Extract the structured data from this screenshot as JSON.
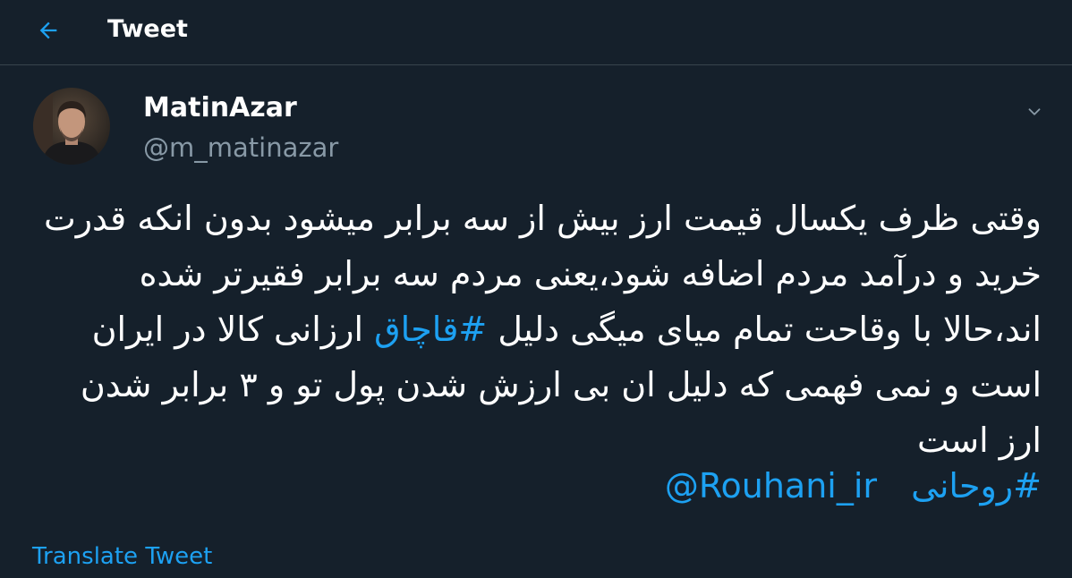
{
  "header": {
    "title": "Tweet",
    "back_icon": "arrow-left-icon"
  },
  "tweet": {
    "author": {
      "name": "MatinAzar",
      "handle": "@m_matinazar"
    },
    "more_icon": "chevron-down-icon",
    "text_before_hashtag": "وقتی ظرف یکسال قیمت ارز بیش از سه برابر میشود بدون انکه قدرت خرید و درآمد مردم اضافه شود،یعنی مردم سه برابر فقیرتر شده اند،حالا با وقاحت تمام میای میگی دلیل ",
    "inline_hashtag": "#قاچاق",
    "text_after_hashtag": " ارزانی کالا در ایران است و نمی فهمی که دلیل ان بی ارزش شدن پول تو و ۳ برابر شدن ارز است",
    "hashtag": "#روحانی",
    "mention": "@Rouhani_ir",
    "translate_label": "Translate Tweet"
  },
  "colors": {
    "background": "#15202b",
    "accent": "#1da1f2",
    "secondary_text": "#8899a6",
    "divider": "#38444d"
  }
}
